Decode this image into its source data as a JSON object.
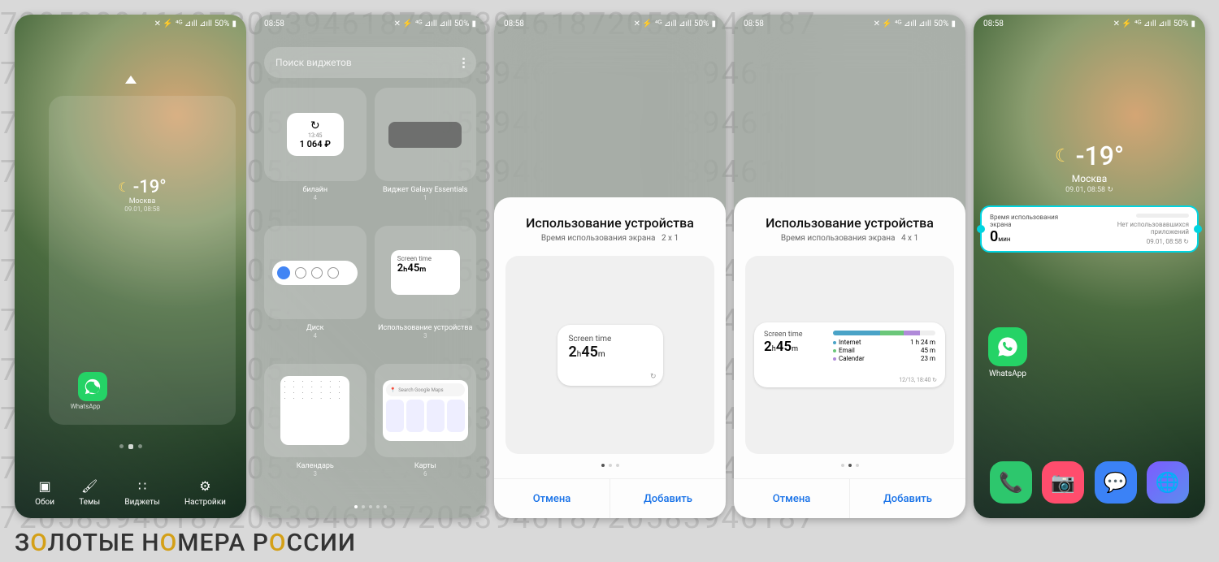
{
  "status": {
    "time": "08:58",
    "battery": "50%",
    "signal": "⁴ᴳ ⊿ıll ⊿ıll"
  },
  "weather": {
    "temp": "-19°",
    "city": "Москва",
    "datetime": "09.01, 08:58",
    "icon": "☾"
  },
  "screen1": {
    "whatsapp": "WhatsApp",
    "bottom": [
      {
        "label": "Обои"
      },
      {
        "label": "Темы"
      },
      {
        "label": "Виджеты"
      },
      {
        "label": "Настройки"
      }
    ]
  },
  "screen2": {
    "search_placeholder": "Поиск виджетов",
    "widgets": [
      {
        "name": "билайн",
        "count": "4",
        "preview_balance": "1 064 ₽",
        "preview_time": "13:45"
      },
      {
        "name": "Виджет Galaxy Essentials",
        "count": "1"
      },
      {
        "name": "Диск",
        "count": "4"
      },
      {
        "name": "Использование устройства",
        "count": "3",
        "st_title": "Screen time",
        "st_value": "2ₕ45ₘ"
      },
      {
        "name": "Календарь",
        "count": "3"
      },
      {
        "name": "Карты",
        "count": "6",
        "maps_hint": "Search Google Maps"
      }
    ]
  },
  "sheet": {
    "title": "Использование устройства",
    "subtitle_label": "Время использования экрана",
    "size_2x1": "2 х 1",
    "size_4x1": "4 х 1",
    "cancel": "Отмена",
    "add": "Добавить",
    "widget2": {
      "title": "Screen time",
      "value_h": "2",
      "value_m": "45",
      "refresh": "↻"
    },
    "widget4": {
      "title": "Screen time",
      "value_h": "2",
      "value_m": "45",
      "apps": [
        {
          "name": "Internet",
          "time": "1 h 24 m",
          "color": "#4aa3c7"
        },
        {
          "name": "Email",
          "time": "45 m",
          "color": "#6bc77a"
        },
        {
          "name": "Calendar",
          "time": "23 m",
          "color": "#b08ad9"
        }
      ],
      "timestamp": "12/13, 18:40 ↻"
    }
  },
  "screen5": {
    "widget": {
      "title": "Время использования экрана",
      "value": "0",
      "unit": "мин",
      "no_apps": "Нет использовавшихся приложений",
      "ts": "09.01, 08:58"
    },
    "whatsapp": "WhatsApp",
    "dock_colors": {
      "phone": "#2dc76d",
      "camera": "#ff4d6d",
      "msg": "#3b82f6",
      "browser": "#7c5cff"
    }
  },
  "watermark": "З ЛОТЫЕ Н МЕРА Р ССИИ",
  "bg_digits": "7205839461872053946187205394618720583946187"
}
